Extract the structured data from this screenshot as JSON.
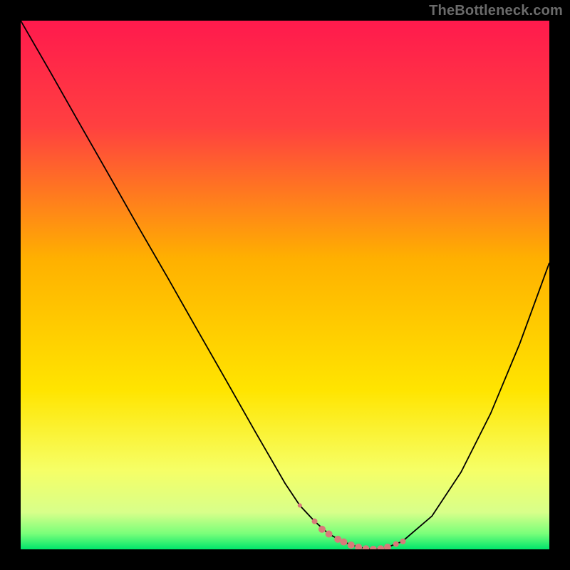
{
  "watermark": "TheBottleneck.com",
  "chart_data": {
    "type": "line",
    "title": "",
    "xlabel": "",
    "ylabel": "",
    "xlim": [
      0,
      100
    ],
    "ylim": [
      0,
      100
    ],
    "background_gradient": {
      "stops": [
        {
          "pos": 0.0,
          "color": "#ff1a4d"
        },
        {
          "pos": 0.2,
          "color": "#ff4040"
        },
        {
          "pos": 0.45,
          "color": "#ffb000"
        },
        {
          "pos": 0.7,
          "color": "#ffe500"
        },
        {
          "pos": 0.85,
          "color": "#f6ff66"
        },
        {
          "pos": 0.93,
          "color": "#d8ff8a"
        },
        {
          "pos": 0.97,
          "color": "#7aff7a"
        },
        {
          "pos": 1.0,
          "color": "#00e56b"
        }
      ]
    },
    "curve": {
      "x": [
        0.0,
        5.6,
        11.1,
        16.7,
        22.2,
        27.8,
        33.3,
        38.9,
        44.4,
        50.0,
        52.8,
        55.6,
        58.3,
        61.1,
        63.9,
        66.7,
        69.4,
        72.2,
        77.8,
        83.3,
        88.9,
        94.4,
        100.0
      ],
      "y": [
        100.0,
        90.3,
        80.6,
        70.8,
        61.1,
        51.4,
        41.7,
        31.9,
        22.2,
        12.5,
        8.3,
        5.3,
        2.9,
        1.4,
        0.4,
        0.0,
        0.4,
        1.5,
        6.3,
        14.6,
        25.7,
        38.9,
        54.2
      ]
    },
    "bottom_markers": {
      "color": "#d87a7a",
      "points": [
        {
          "x": 52.8,
          "y": 8.3,
          "r": 3
        },
        {
          "x": 55.6,
          "y": 5.3,
          "r": 4
        },
        {
          "x": 57.0,
          "y": 3.8,
          "r": 5
        },
        {
          "x": 58.3,
          "y": 2.9,
          "r": 5
        },
        {
          "x": 60.0,
          "y": 1.9,
          "r": 5
        },
        {
          "x": 61.1,
          "y": 1.4,
          "r": 5
        },
        {
          "x": 62.5,
          "y": 0.8,
          "r": 5
        },
        {
          "x": 63.9,
          "y": 0.4,
          "r": 5
        },
        {
          "x": 65.3,
          "y": 0.1,
          "r": 5
        },
        {
          "x": 66.7,
          "y": 0.0,
          "r": 5
        },
        {
          "x": 68.1,
          "y": 0.1,
          "r": 5
        },
        {
          "x": 69.4,
          "y": 0.4,
          "r": 5
        },
        {
          "x": 71.0,
          "y": 1.0,
          "r": 4
        },
        {
          "x": 72.3,
          "y": 1.5,
          "r": 4
        }
      ]
    }
  }
}
